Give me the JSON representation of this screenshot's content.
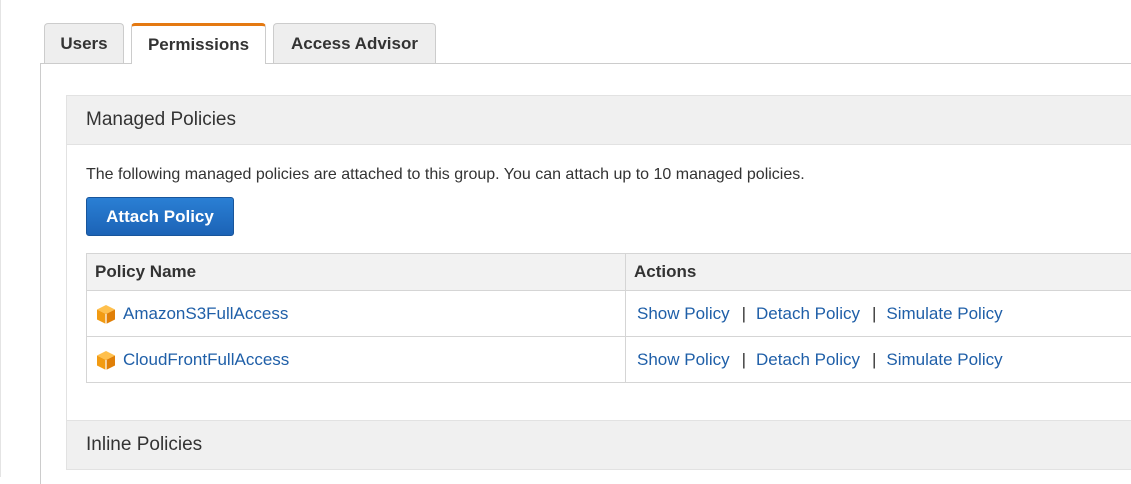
{
  "tabs": [
    {
      "label": "Users",
      "active": false
    },
    {
      "label": "Permissions",
      "active": true
    },
    {
      "label": "Access Advisor",
      "active": false
    }
  ],
  "managed": {
    "title": "Managed Policies",
    "description": "The following managed policies are attached to this group. You can attach up to 10 managed policies.",
    "attach_button": "Attach Policy",
    "columns": [
      "Policy Name",
      "Actions"
    ],
    "rows": [
      {
        "name": "AmazonS3FullAccess",
        "icon": "aws-policy-cube-icon"
      },
      {
        "name": "CloudFrontFullAccess",
        "icon": "aws-policy-cube-icon"
      }
    ],
    "actions": {
      "show": "Show Policy",
      "detach": "Detach Policy",
      "simulate": "Simulate Policy",
      "separator": "|"
    }
  },
  "inline": {
    "title": "Inline Policies"
  },
  "colors": {
    "accent": "#e47911",
    "link": "#1f5fa8",
    "button": "#1c63b6",
    "icon": "#f39c12"
  }
}
